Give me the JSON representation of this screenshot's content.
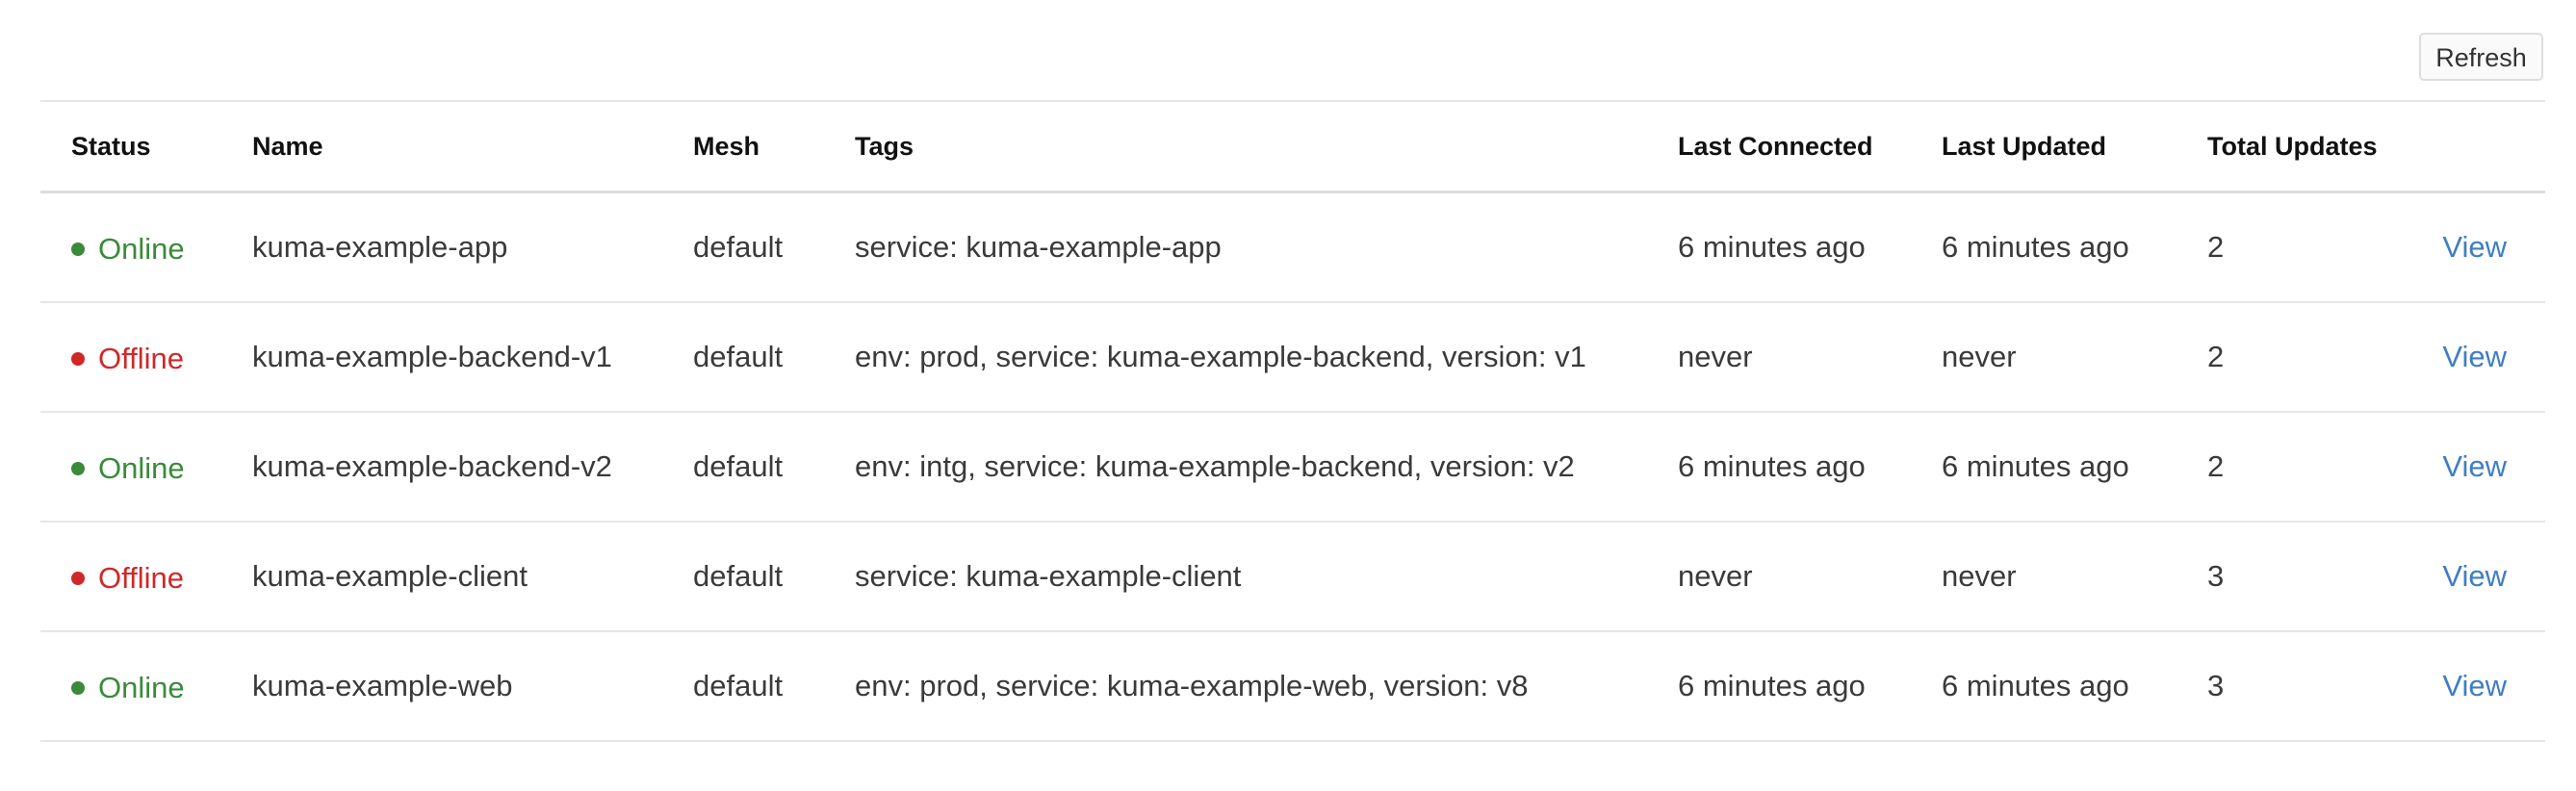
{
  "toolbar": {
    "refresh_label": "Refresh"
  },
  "colors": {
    "online": "#3a8a3a",
    "offline": "#d02828",
    "link": "#3f7ec4"
  },
  "table": {
    "columns": [
      "Status",
      "Name",
      "Mesh",
      "Tags",
      "Last Connected",
      "Last Updated",
      "Total Updates"
    ],
    "rows": [
      {
        "status": "Online",
        "name": "kuma-example-app",
        "mesh": "default",
        "tags": "service: kuma-example-app",
        "last_connected": "6 minutes ago",
        "last_updated": "6 minutes ago",
        "total_updates": "2",
        "action": "View"
      },
      {
        "status": "Offline",
        "name": "kuma-example-backend-v1",
        "mesh": "default",
        "tags": "env: prod, service: kuma-example-backend, version: v1",
        "last_connected": "never",
        "last_updated": "never",
        "total_updates": "2",
        "action": "View"
      },
      {
        "status": "Online",
        "name": "kuma-example-backend-v2",
        "mesh": "default",
        "tags": "env: intg, service: kuma-example-backend, version: v2",
        "last_connected": "6 minutes ago",
        "last_updated": "6 minutes ago",
        "total_updates": "2",
        "action": "View"
      },
      {
        "status": "Offline",
        "name": "kuma-example-client",
        "mesh": "default",
        "tags": "service: kuma-example-client",
        "last_connected": "never",
        "last_updated": "never",
        "total_updates": "3",
        "action": "View"
      },
      {
        "status": "Online",
        "name": "kuma-example-web",
        "mesh": "default",
        "tags": "env: prod, service: kuma-example-web, version: v8",
        "last_connected": "6 minutes ago",
        "last_updated": "6 minutes ago",
        "total_updates": "3",
        "action": "View"
      }
    ]
  }
}
